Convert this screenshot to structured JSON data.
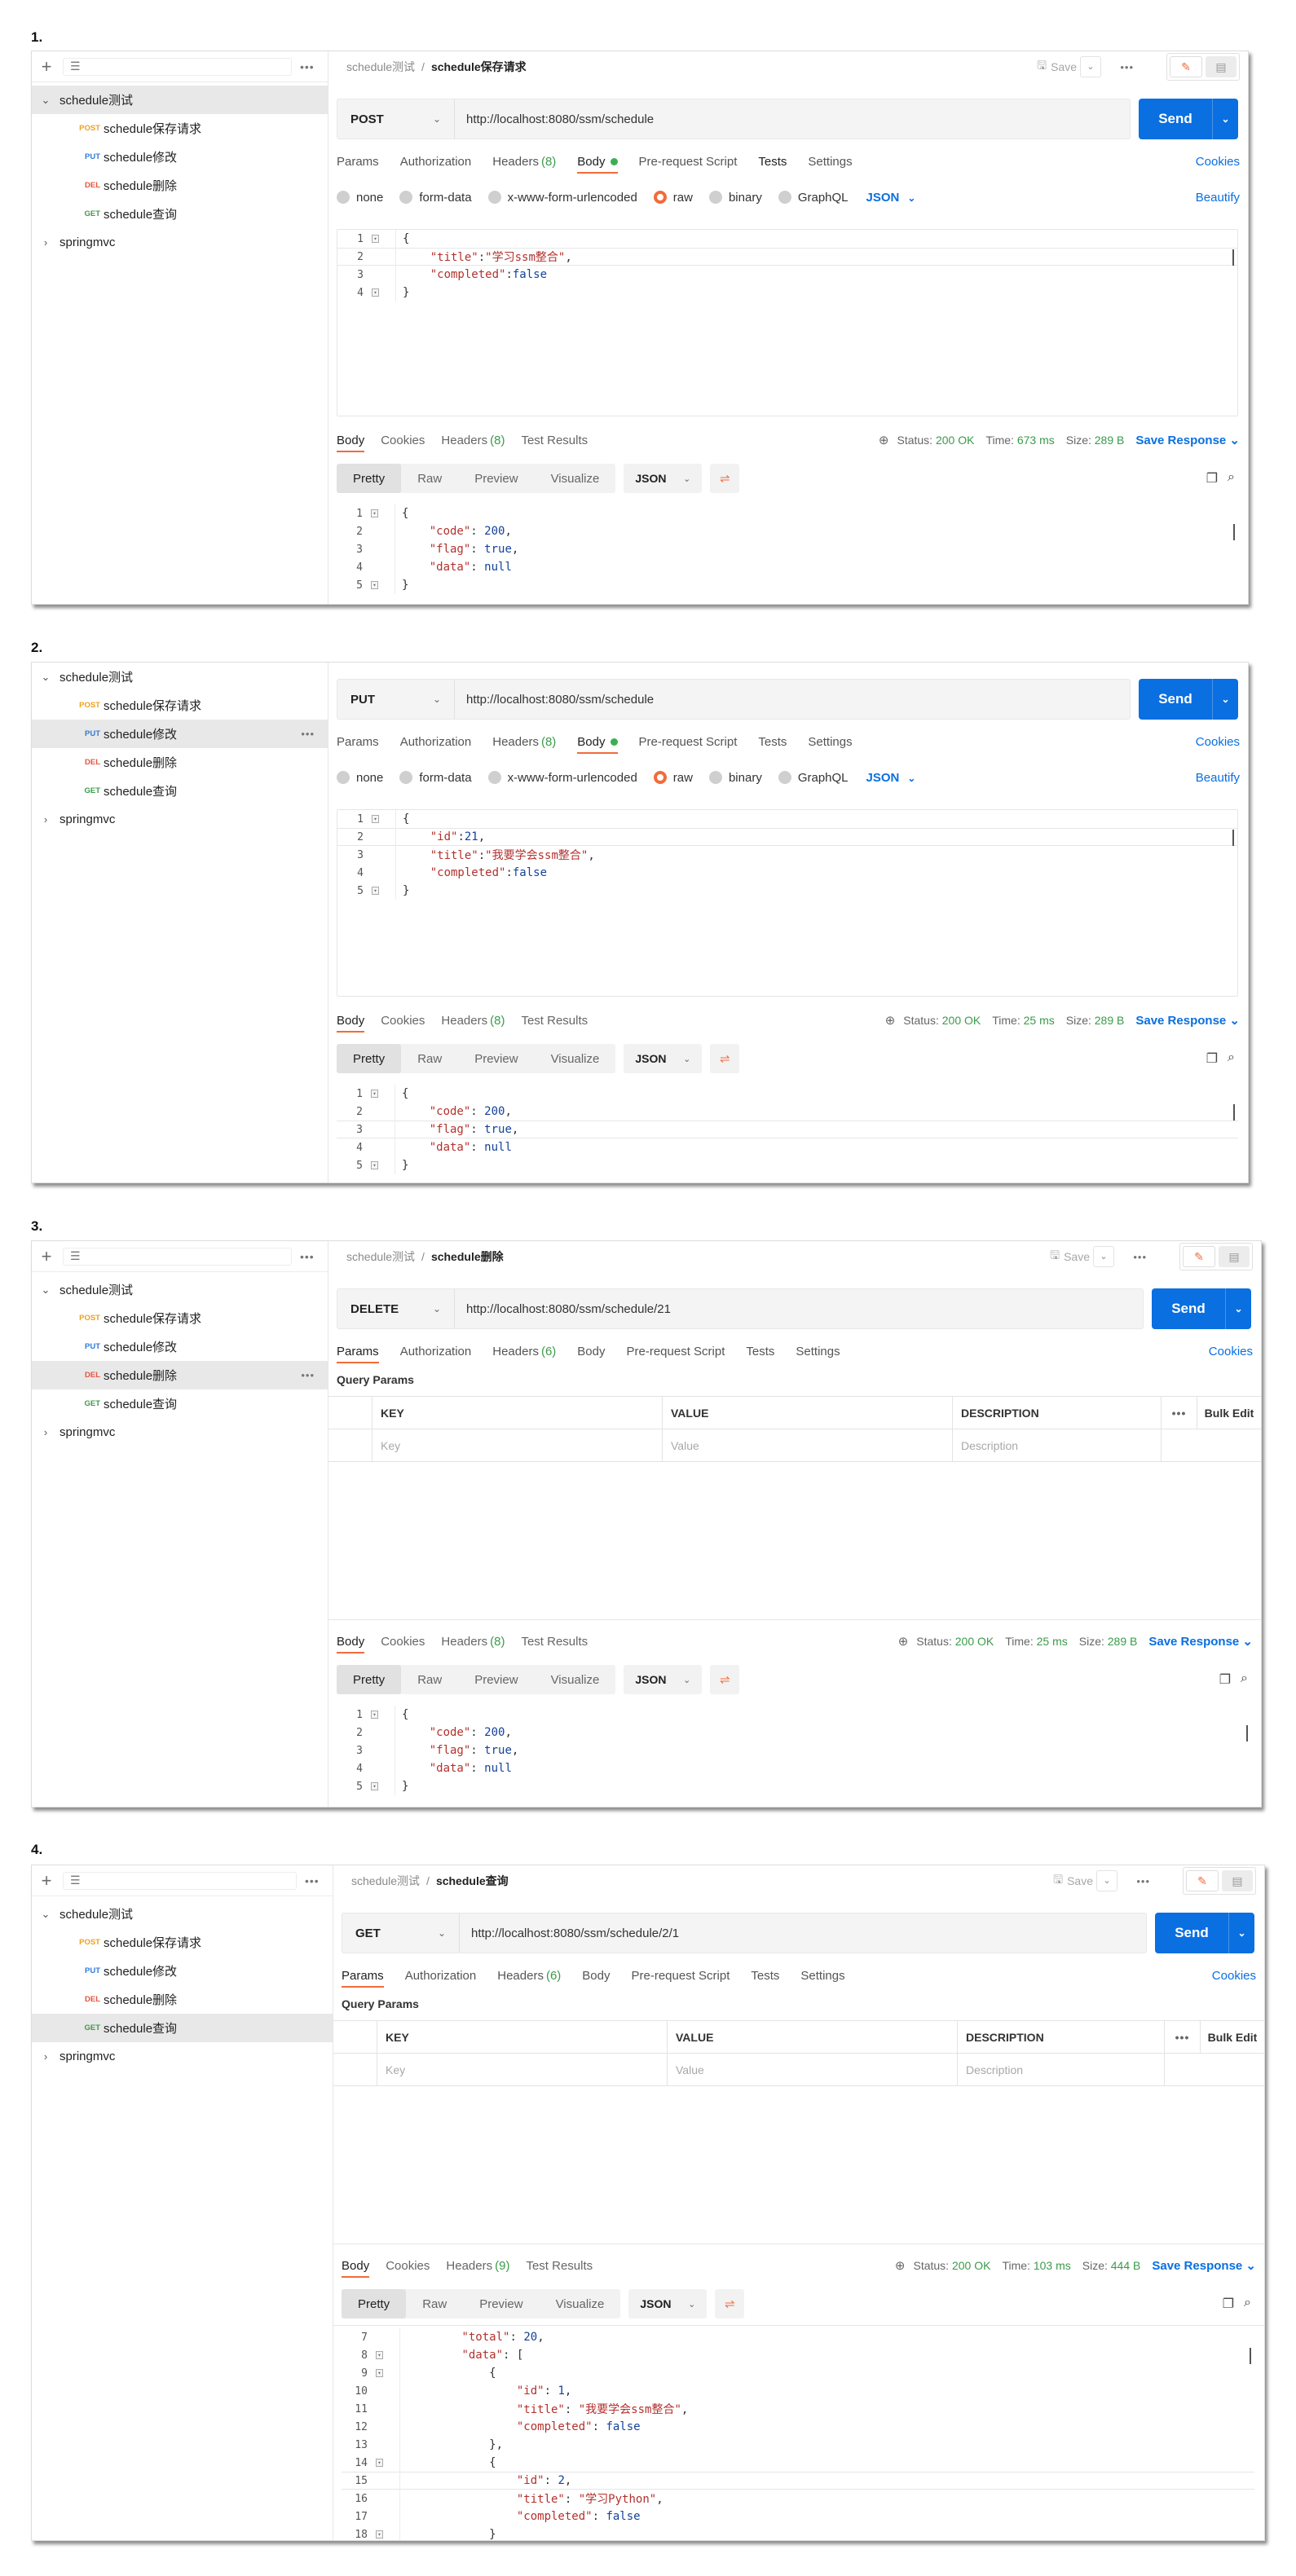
{
  "sidebar": {
    "collection": "schedule测试",
    "other_collection": "springmvc",
    "items": [
      {
        "method": "POST",
        "name": "schedule保存请求"
      },
      {
        "method": "PUT",
        "name": "schedule修改"
      },
      {
        "method": "DEL",
        "name": "schedule删除"
      },
      {
        "method": "GET",
        "name": "schedule查询"
      }
    ]
  },
  "common": {
    "save": "Save",
    "send": "Send",
    "cookies": "Cookies",
    "beautify": "Beautify",
    "req_tabs": [
      "Params",
      "Authorization",
      "Headers",
      "Body",
      "Pre-request Script",
      "Tests",
      "Settings"
    ],
    "body_types": [
      "none",
      "form-data",
      "x-www-form-urlencoded",
      "raw",
      "binary",
      "GraphQL"
    ],
    "json": "JSON",
    "res_tabs": [
      "Body",
      "Cookies",
      "Headers",
      "Test Results"
    ],
    "res_views": [
      "Pretty",
      "Raw",
      "Preview",
      "Visualize"
    ],
    "status_label": "Status:",
    "time_label": "Time:",
    "size_label": "Size:",
    "save_response": "Save Response",
    "query_params": "Query Params",
    "col_key": "KEY",
    "col_value": "VALUE",
    "col_desc": "DESCRIPTION",
    "bulk_edit": "Bulk Edit",
    "ph_key": "Key",
    "ph_value": "Value",
    "ph_desc": "Description"
  },
  "steps": [
    {
      "label": "1.",
      "crumb": "schedule测试",
      "title": "schedule保存请求",
      "method": "POST",
      "url": "http://localhost:8080/ssm/schedule",
      "headers_count": "(8)",
      "status": "200 OK",
      "time": "673 ms",
      "size": "289 B",
      "res_headers": "(8)"
    },
    {
      "label": "2.",
      "method": "PUT",
      "url": "http://localhost:8080/ssm/schedule",
      "headers_count": "(8)",
      "status": "200 OK",
      "time": "25 ms",
      "size": "289 B",
      "res_headers": "(8)"
    },
    {
      "label": "3.",
      "crumb": "schedule测试",
      "title": "schedule删除",
      "method": "DELETE",
      "url": "http://localhost:8080/ssm/schedule/21",
      "headers_count": "(6)",
      "status": "200 OK",
      "time": "25 ms",
      "size": "289 B",
      "res_headers": "(8)"
    },
    {
      "label": "4.",
      "crumb": "schedule测试",
      "title": "schedule查询",
      "method": "GET",
      "url": "http://localhost:8080/ssm/schedule/2/1",
      "headers_count": "(6)",
      "status": "200 OK",
      "time": "103 ms",
      "size": "444 B",
      "res_headers": "(9)"
    }
  ],
  "code": {
    "req1": [
      {
        "n": "1",
        "t": "{"
      },
      {
        "n": "2",
        "t": "    \"title\":\"学习ssm整合\","
      },
      {
        "n": "3",
        "t": "    \"completed\":false"
      },
      {
        "n": "4",
        "t": "}"
      }
    ],
    "req2": [
      {
        "n": "1",
        "t": "{"
      },
      {
        "n": "2",
        "t": "    \"id\":21,"
      },
      {
        "n": "3",
        "t": "    \"title\":\"我要学会ssm整合\","
      },
      {
        "n": "4",
        "t": "    \"completed\":false"
      },
      {
        "n": "5",
        "t": "}"
      }
    ],
    "res_basic": [
      {
        "n": "1",
        "t": "{"
      },
      {
        "n": "2",
        "t": "    \"code\": 200,"
      },
      {
        "n": "3",
        "t": "    \"flag\": true,"
      },
      {
        "n": "4",
        "t": "    \"data\": null"
      },
      {
        "n": "5",
        "t": "}"
      }
    ],
    "res4": [
      {
        "n": "7",
        "t": "        \"total\": 20,"
      },
      {
        "n": "8",
        "t": "        \"data\": ["
      },
      {
        "n": "9",
        "t": "            {"
      },
      {
        "n": "10",
        "t": "                \"id\": 1,"
      },
      {
        "n": "11",
        "t": "                \"title\": \"我要学会ssm整合\","
      },
      {
        "n": "12",
        "t": "                \"completed\": false"
      },
      {
        "n": "13",
        "t": "            },"
      },
      {
        "n": "14",
        "t": "            {"
      },
      {
        "n": "15",
        "t": "                \"id\": 2,"
      },
      {
        "n": "16",
        "t": "                \"title\": \"学习Python\","
      },
      {
        "n": "17",
        "t": "                \"completed\": false"
      },
      {
        "n": "18",
        "t": "            }"
      }
    ]
  }
}
